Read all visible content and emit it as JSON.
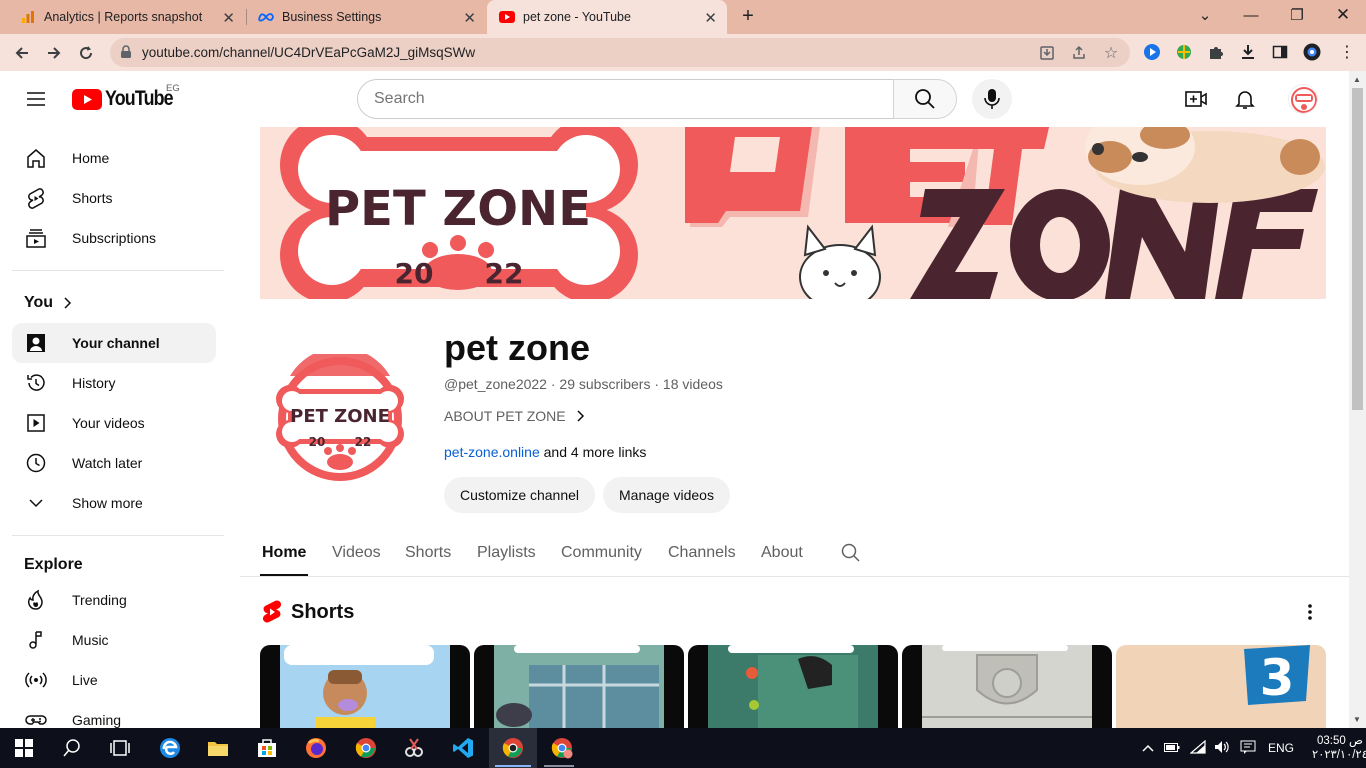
{
  "browser": {
    "tabs": [
      {
        "title": "Analytics | Reports snapshot",
        "icon": "analytics-icon"
      },
      {
        "title": "Business Settings",
        "icon": "meta-icon"
      },
      {
        "title": "pet zone - YouTube",
        "icon": "youtube-icon"
      }
    ],
    "url": "youtube.com/channel/UC4DrVEaPcGaM2J_giMsqSWw"
  },
  "masthead": {
    "logo_text": "YouTube",
    "country_code": "EG",
    "search_placeholder": "Search"
  },
  "sidebar": {
    "main": [
      {
        "label": "Home",
        "icon": "home-icon"
      },
      {
        "label": "Shorts",
        "icon": "shorts-icon"
      },
      {
        "label": "Subscriptions",
        "icon": "subscriptions-icon"
      }
    ],
    "you_heading": "You",
    "you": [
      {
        "label": "Your channel",
        "icon": "channel-icon",
        "active": true
      },
      {
        "label": "History",
        "icon": "history-icon"
      },
      {
        "label": "Your videos",
        "icon": "videos-icon"
      },
      {
        "label": "Watch later",
        "icon": "clock-icon"
      },
      {
        "label": "Show more",
        "icon": "chevron-down-icon"
      }
    ],
    "explore_heading": "Explore",
    "explore": [
      {
        "label": "Trending",
        "icon": "trending-icon"
      },
      {
        "label": "Music",
        "icon": "music-icon"
      },
      {
        "label": "Live",
        "icon": "live-icon"
      },
      {
        "label": "Gaming",
        "icon": "gaming-icon"
      }
    ]
  },
  "banner": {
    "logo_title": "PET ZONE",
    "logo_year_left": "20",
    "logo_year_right": "22"
  },
  "channel": {
    "name": "pet zone",
    "handle": "@pet_zone2022",
    "subscribers": "29 subscribers",
    "videos": "18 videos",
    "about_label": "ABOUT PET ZONE",
    "link_text": "pet-zone.online",
    "more_links": "and 4 more links",
    "customize_label": "Customize channel",
    "manage_label": "Manage videos",
    "avatar_title": "PET ZONE",
    "avatar_year_left": "20",
    "avatar_year_right": "22"
  },
  "channel_tabs": [
    "Home",
    "Videos",
    "Shorts",
    "Playlists",
    "Community",
    "Channels",
    "About"
  ],
  "shorts_section": {
    "title": "Shorts",
    "thumb_badge": "3"
  },
  "taskbar": {
    "lang": "ENG",
    "time": "03:50",
    "ampm": "ص",
    "date": "٢٠٢٣/١٠/٢٤"
  }
}
